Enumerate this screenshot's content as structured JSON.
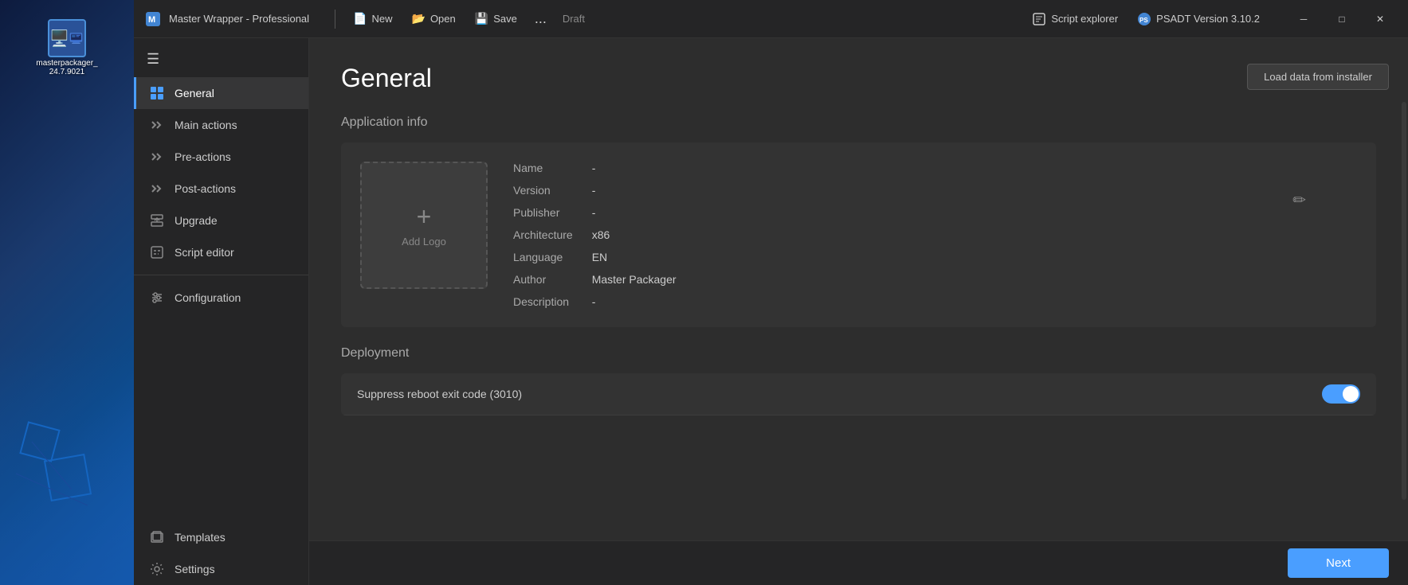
{
  "desktop": {
    "icon": {
      "label": "masterpackager_24.7.9021",
      "emoji": "🖥️"
    }
  },
  "titlebar": {
    "logo_alt": "master-wrapper-logo",
    "title": "Master Wrapper - Professional",
    "separator": true,
    "new_label": "New",
    "open_label": "Open",
    "save_label": "Save",
    "more_label": "...",
    "draft_label": "Draft",
    "script_explorer_label": "Script explorer",
    "psadt_version_label": "PSADT Version 3.10.2",
    "minimize_icon": "─",
    "maximize_icon": "□",
    "close_icon": "✕"
  },
  "sidebar": {
    "hamburger_icon": "☰",
    "items": [
      {
        "id": "general",
        "label": "General",
        "icon": "grid",
        "active": true
      },
      {
        "id": "main-actions",
        "label": "Main actions",
        "icon": "double-chevron"
      },
      {
        "id": "pre-actions",
        "label": "Pre-actions",
        "icon": "double-chevron"
      },
      {
        "id": "post-actions",
        "label": "Post-actions",
        "icon": "double-chevron"
      },
      {
        "id": "upgrade",
        "label": "Upgrade",
        "icon": "upgrade"
      },
      {
        "id": "script-editor",
        "label": "Script editor",
        "icon": "code"
      }
    ],
    "divider": true,
    "bottom_items": [
      {
        "id": "configuration",
        "label": "Configuration",
        "icon": "sliders"
      },
      {
        "id": "templates",
        "label": "Templates",
        "icon": "layers"
      },
      {
        "id": "settings",
        "label": "Settings",
        "icon": "gear"
      }
    ]
  },
  "page": {
    "title": "General",
    "load_data_btn": "Load data from installer",
    "app_info_section": "Application info",
    "logo_placeholder": "Add Logo",
    "edit_icon": "✏",
    "fields": [
      {
        "label": "Name",
        "value": "-"
      },
      {
        "label": "Version",
        "value": "-"
      },
      {
        "label": "Publisher",
        "value": "-"
      },
      {
        "label": "Architecture",
        "value": "x86"
      },
      {
        "label": "Language",
        "value": "EN"
      },
      {
        "label": "Author",
        "value": "Master Packager"
      },
      {
        "label": "Description",
        "value": "-"
      }
    ],
    "deployment_section": "Deployment",
    "deployment_rows": [
      {
        "label": "Suppress reboot exit code (3010)",
        "toggle": true
      }
    ]
  },
  "footer": {
    "next_label": "Next"
  }
}
